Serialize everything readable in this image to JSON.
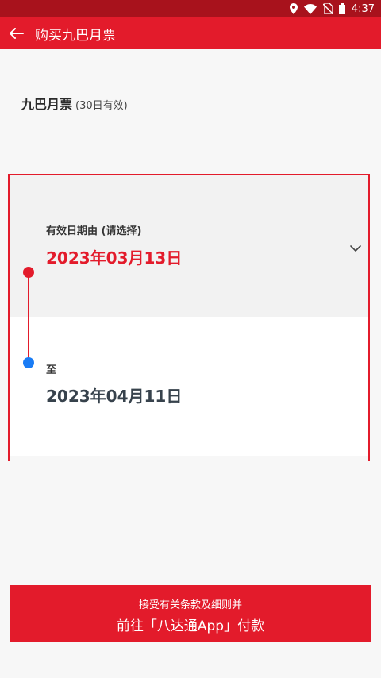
{
  "status_bar": {
    "time": "4:37",
    "icons": [
      "location-icon",
      "wifi-icon",
      "no-sim-icon",
      "battery-icon"
    ]
  },
  "app_bar": {
    "back_icon": "arrow-left-icon",
    "title": "购买九巴月票"
  },
  "ticket": {
    "name": "九巴月票",
    "validity": "(30日有效)"
  },
  "date_range": {
    "from_label": "有效日期由 (请选择)",
    "from_date": "2023年03月13日",
    "to_label": "至",
    "to_date": "2023年04月11日",
    "dropdown_icon": "chevron-down-icon"
  },
  "pay_button": {
    "line1": "接受有关条款及细则并",
    "line2": "前往「八达通App」付款"
  },
  "colors": {
    "accent": "#e31b2b",
    "status_bar": "#a8121c",
    "end_dot": "#1a7cf5",
    "to_date": "#37424c"
  }
}
